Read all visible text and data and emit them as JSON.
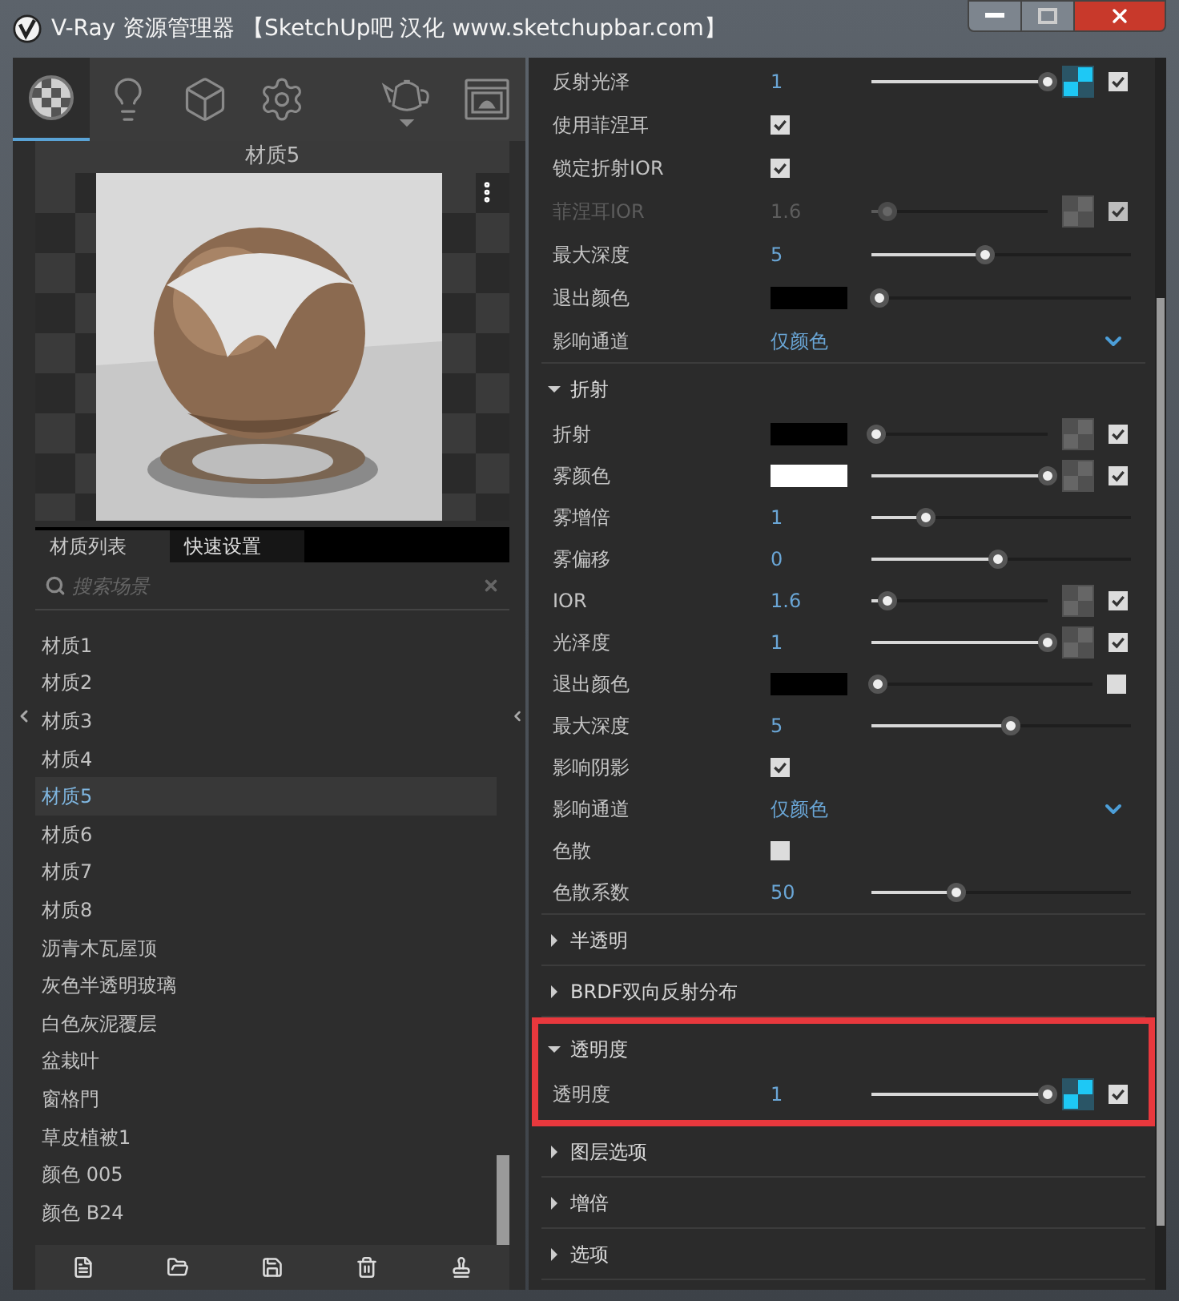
{
  "window": {
    "title": "V-Ray 资源管理器 【SketchUp吧 汉化 www.sketchupbar.com】"
  },
  "toolbar": [
    {
      "kind": "materials",
      "selected": true
    },
    {
      "kind": "lights",
      "selected": false
    },
    {
      "kind": "geometry",
      "selected": false
    },
    {
      "kind": "settings",
      "selected": false
    },
    {
      "kind": "render",
      "selected": false
    },
    {
      "kind": "frame-buffer",
      "selected": false
    }
  ],
  "preview": {
    "title": "材质5"
  },
  "tabs": [
    {
      "label": "材质列表",
      "selected": true
    },
    {
      "label": "快速设置",
      "selected": false
    }
  ],
  "search": {
    "placeholder": "搜索场景"
  },
  "materials": [
    {
      "name": "材质1",
      "selected": false
    },
    {
      "name": "材质2",
      "selected": false
    },
    {
      "name": "材质3",
      "selected": false
    },
    {
      "name": "材质4",
      "selected": false
    },
    {
      "name": "材质5",
      "selected": true
    },
    {
      "name": "材质6",
      "selected": false
    },
    {
      "name": "材质7",
      "selected": false
    },
    {
      "name": "材质8",
      "selected": false
    },
    {
      "name": "沥青木瓦屋顶",
      "selected": false
    },
    {
      "name": "灰色半透明玻璃",
      "selected": false
    },
    {
      "name": "白色灰泥覆层",
      "selected": false
    },
    {
      "name": "盆栽叶",
      "selected": false
    },
    {
      "name": "窗格門",
      "selected": false
    },
    {
      "name": "草皮植被1",
      "selected": false
    },
    {
      "name": "颜色 005",
      "selected": false
    },
    {
      "name": "颜色 B24",
      "selected": false
    }
  ],
  "sections": [
    {
      "expanded": true,
      "highlighted": false,
      "rows": [
        {
          "label": "反射光泽",
          "kind": "number",
          "value": "1",
          "level": 1,
          "map_active": true,
          "checked": true,
          "disabled": false
        },
        {
          "label": "使用菲涅耳",
          "kind": "checkbox",
          "checked": true,
          "disabled": false
        },
        {
          "label": "锁定折射IOR",
          "kind": "checkbox",
          "checked": true,
          "disabled": false
        },
        {
          "label": "菲涅耳IOR",
          "kind": "number",
          "value": "1.6",
          "level": 0.09,
          "map_active": false,
          "checked": true,
          "disabled": true
        },
        {
          "label": "最大深度",
          "kind": "number",
          "value": "5",
          "level": 0.44,
          "disabled": false
        },
        {
          "label": "退出颜色",
          "kind": "color",
          "color": "#000000",
          "level": 0.03,
          "disabled": false
        },
        {
          "label": "影响通道",
          "kind": "dropdown",
          "value": "仅颜色",
          "disabled": false
        }
      ]
    },
    {
      "title": "折射",
      "expanded": true,
      "highlighted": false,
      "rows": [
        {
          "label": "折射",
          "kind": "color",
          "color": "#000000",
          "level": 0.03,
          "map_active": false,
          "checked": true,
          "disabled": false
        },
        {
          "label": "雾颜色",
          "kind": "color",
          "color": "#ffffff",
          "level": 1,
          "map_active": false,
          "checked": true,
          "disabled": false
        },
        {
          "label": "雾增倍",
          "kind": "number",
          "value": "1",
          "level": 0.21,
          "disabled": false
        },
        {
          "label": "雾偏移",
          "kind": "number",
          "value": "0",
          "level": 0.49,
          "disabled": false
        },
        {
          "label": "IOR",
          "kind": "number",
          "value": "1.6",
          "level": 0.09,
          "map_active": false,
          "checked": true,
          "disabled": false
        },
        {
          "label": "光泽度",
          "kind": "number",
          "value": "1",
          "level": 1,
          "map_active": false,
          "checked": true,
          "disabled": false
        },
        {
          "label": "退出颜色",
          "kind": "color",
          "color": "#000000",
          "level": 0.03,
          "checked": false,
          "disabled": false
        },
        {
          "label": "最大深度",
          "kind": "number",
          "value": "5",
          "level": 0.54,
          "disabled": false
        },
        {
          "label": "影响阴影",
          "kind": "checkbox",
          "checked": true,
          "disabled": false
        },
        {
          "label": "影响通道",
          "kind": "dropdown",
          "value": "仅颜色",
          "disabled": false
        },
        {
          "label": "色散",
          "kind": "checkbox",
          "checked": false,
          "disabled": false
        },
        {
          "label": "色散系数",
          "kind": "number",
          "value": "50",
          "level": 0.33,
          "disabled": false
        }
      ]
    },
    {
      "title": "半透明",
      "expanded": false,
      "highlighted": false
    },
    {
      "title": "BRDF双向反射分布",
      "expanded": false,
      "highlighted": false
    },
    {
      "title": "透明度",
      "expanded": true,
      "highlighted": true,
      "rows": [
        {
          "label": "透明度",
          "kind": "number",
          "value": "1",
          "level": 1,
          "map_active": true,
          "checked": true,
          "disabled": false
        }
      ]
    },
    {
      "title": "图层选项",
      "expanded": false,
      "highlighted": false
    },
    {
      "title": "增倍",
      "expanded": false,
      "highlighted": false
    },
    {
      "title": "选项",
      "expanded": false,
      "highlighted": false
    }
  ]
}
